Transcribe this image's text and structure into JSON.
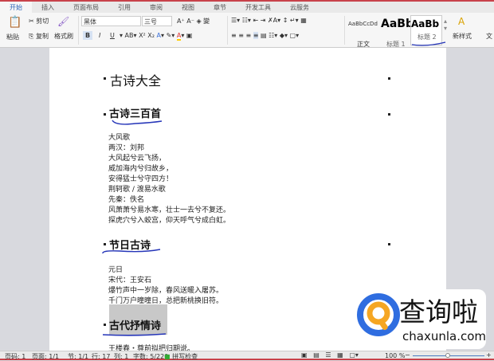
{
  "tabs": [
    "开始",
    "插入",
    "页面布局",
    "引用",
    "审阅",
    "视图",
    "章节",
    "开发工具",
    "云服务"
  ],
  "toolbar": {
    "paste": "粘贴",
    "cut": "剪切",
    "copy": "复制",
    "format_painter": "格式刷",
    "font": "黑体",
    "size": "三号",
    "bold": "B",
    "italic": "I",
    "underline": "U",
    "new_style": "新样式",
    "text": "文"
  },
  "styles": [
    {
      "preview": "AaBbCcDd",
      "label": "正文"
    },
    {
      "preview": "AaBb",
      "label": "标题 1"
    },
    {
      "preview": "AaBb",
      "label": "标题 2"
    }
  ],
  "doc": {
    "title": "古诗大全",
    "h1": "古诗三百首",
    "lines1": [
      "大风歌",
      "两汉：刘邦",
      "大风起兮云飞扬，",
      "威加海内兮归故乡，",
      "安得猛士兮守四方！",
      "荆轲歌 / 渡易水歌",
      "先秦：佚名",
      "风萧萧兮易水寒，壮士一去兮不复还。",
      "探虎穴兮入蛟宫，仰天呼气兮成白虹。"
    ],
    "h2": "节日古诗",
    "lines2": [
      "元日",
      "宋代：王安石",
      "爆竹声中一岁除，春风送暖入屠苏。",
      "千门万户曈曈日，总把新桃换旧符。"
    ],
    "h3": "古代抒情诗",
    "last": "王楼春・尊前拟把归期说。"
  },
  "status": {
    "page_num": "页码: 1",
    "pages": "页面: 1/1",
    "section": "节: 1/1",
    "row": "行: 17",
    "col": "列: 1",
    "words": "字数: 5/220",
    "spell": "拼写检查",
    "zoom": "100 %"
  },
  "watermark": {
    "name": "查询啦",
    "url": "chaxunla.com"
  }
}
